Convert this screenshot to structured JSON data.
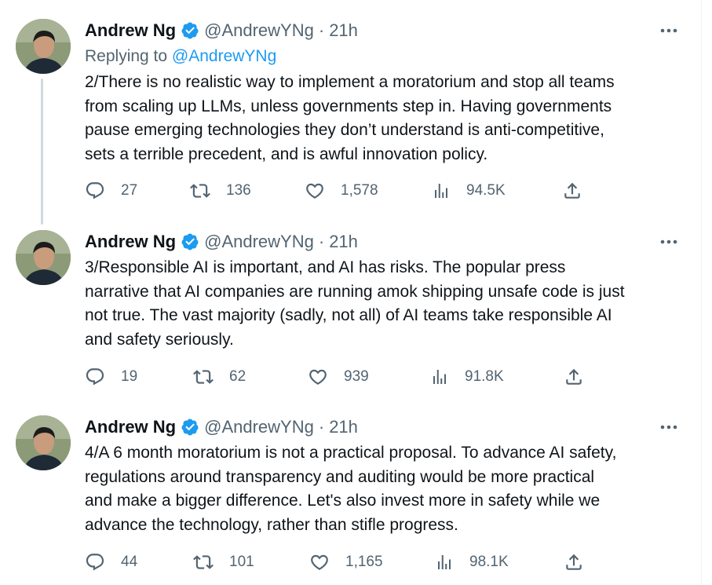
{
  "tweets": [
    {
      "author": "Andrew Ng",
      "handle": "@AndrewYNg",
      "separator": "·",
      "time": "21h",
      "replying_label": "Replying to ",
      "replying_to": "@AndrewYNg",
      "lines": [
        "2/There is no realistic way to implement a moratorium and stop all teams",
        "from scaling up LLMs, unless governments step in. Having governments",
        "pause emerging technologies they don’t understand is anti-competitive,",
        "sets a terrible precedent, and is awful innovation policy."
      ],
      "replies": "27",
      "retweets": "136",
      "likes": "1,578",
      "views": "94.5K"
    },
    {
      "author": "Andrew Ng",
      "handle": "@AndrewYNg",
      "separator": "·",
      "time": "21h",
      "lines": [
        "3/Responsible AI is important, and AI has risks. The popular press",
        "narrative that AI companies are running amok shipping unsafe code is just",
        "not true. The vast majority (sadly, not all) of AI teams take responsible AI",
        "and safety seriously."
      ],
      "replies": "19",
      "retweets": "62",
      "likes": "939",
      "views": "91.8K"
    },
    {
      "author": "Andrew Ng",
      "handle": "@AndrewYNg",
      "separator": "·",
      "time": "21h",
      "lines": [
        "4/A 6 month moratorium is not a practical proposal. To advance AI safety,",
        "regulations around transparency and auditing would be more practical",
        "and make a bigger difference. Let's also invest more in safety while we",
        "advance the technology, rather than stifle progress."
      ],
      "replies": "44",
      "retweets": "101",
      "likes": "1,165",
      "views": "98.1K"
    }
  ],
  "icons": {
    "verified": "verified-badge-icon",
    "more": "more-dots-icon",
    "reply": "reply-bubble-icon",
    "retweet": "retweet-icon",
    "like": "heart-icon",
    "views": "views-bars-icon",
    "share": "share-icon"
  },
  "colors": {
    "text": "#0f1419",
    "secondary": "#536471",
    "accent": "#1d9bf0",
    "thread_line": "#cfd9de"
  }
}
